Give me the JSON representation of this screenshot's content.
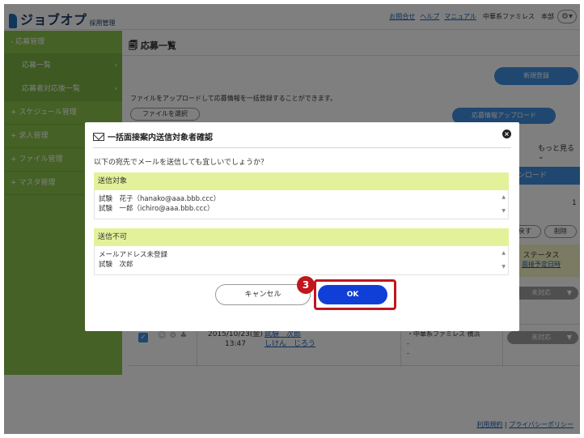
{
  "header": {
    "logo_text": "ジョブオプ",
    "logo_sub": "採用管理",
    "links": [
      "お問合せ",
      "ヘルプ",
      "マニュアル"
    ],
    "company": "中華系ファミレス　本部",
    "gear_icon": "gear-icon"
  },
  "sidebar": {
    "items": [
      {
        "label": "応募管理",
        "prefix": "-"
      },
      {
        "label": "応募一覧",
        "prefix": ""
      },
      {
        "label": "応募者対応後一覧",
        "prefix": ""
      },
      {
        "label": "スケジュール管理",
        "prefix": "+"
      },
      {
        "label": "求人管理",
        "prefix": "+"
      },
      {
        "label": "ファイル管理",
        "prefix": "+"
      },
      {
        "label": "マスタ管理",
        "prefix": "+"
      }
    ]
  },
  "main": {
    "title": "応募一覧",
    "new_button": "新規登録",
    "upload_note": "ファイルをアップロードして応募情報を一括登録することができます。",
    "file_button": "ファイルを選択",
    "upload_button": "応募情報アップロード",
    "more_link": "もっと見る",
    "download_button": "ウンロード",
    "count": "1",
    "restore_button": "戻す",
    "delete_button": "削除",
    "status_header": "ステータス",
    "status_link": "面接予定日時",
    "status_value": "未対応",
    "row": {
      "date": "2015/10/23(金)",
      "time": "13:47",
      "name": "試験　次郎",
      "kana": "しけん　じろう",
      "route": "・中華系ファミレス 横浜",
      "route2": "-",
      "route3": "-"
    }
  },
  "footer": {
    "terms": "利用規約",
    "privacy": "プライバシーポリシー"
  },
  "dialog": {
    "title": "一括面接案内送信対象者確認",
    "message": "以下の宛先でメールを送信しても宜しいでしょうか？",
    "section_send": "送信対象",
    "send_targets": [
      "試験　花子（hanako@aaa.bbb.ccc）",
      "試験　一郎（ichiro@aaa.bbb.ccc）"
    ],
    "section_unsendable": "送信不可",
    "unsendable": [
      "メールアドレス未登録",
      "試験　次郎"
    ],
    "cancel_button": "キャンセル",
    "ok_button": "OK",
    "step_number": "3"
  },
  "colors": {
    "sidebar": "#8bc34a",
    "accent_blue": "#3f8fe0",
    "ok_blue": "#0f3fd6",
    "highlight_red": "#c0161c",
    "section_yellow": "#e3f29a"
  }
}
